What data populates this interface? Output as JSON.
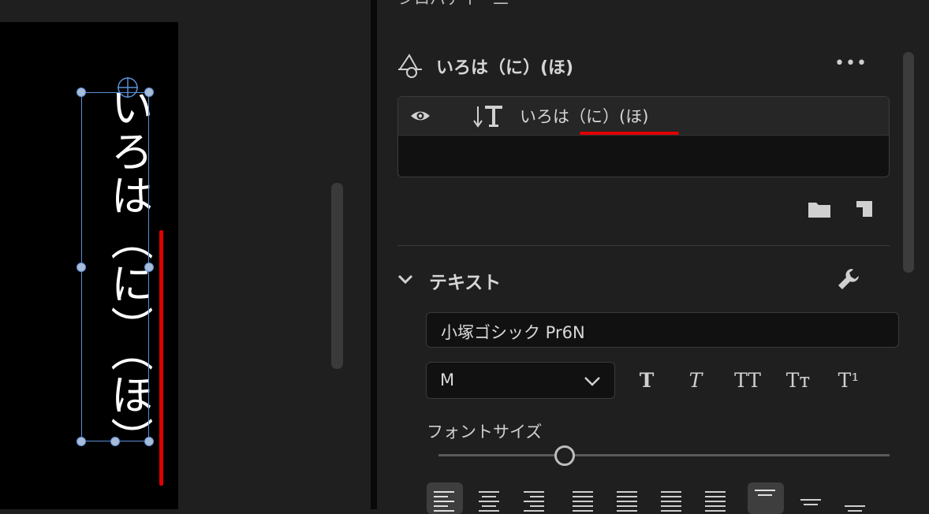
{
  "monitor": {
    "vertical_text": "いろは（に）（ほ）"
  },
  "panel": {
    "title": "ンロパテイー二"
  },
  "layer_group": {
    "name": "いろは（に）(ほ)",
    "more_label": "•••"
  },
  "layers": [
    {
      "name": "いろは（に）(ほ)"
    }
  ],
  "text_section": {
    "title": "テキスト",
    "font_family": "小塚ゴシック Pr6N",
    "font_weight": "M",
    "styles": {
      "bold": "T",
      "italic": "T",
      "all_caps": "TT",
      "small_caps": "Tт",
      "superscript": "T¹"
    },
    "font_size_label": "フォントサイズ",
    "font_size_fraction": 0.28
  },
  "colors": {
    "annotation_red": "#e00000",
    "selection_blue": "#5b8fd6"
  }
}
